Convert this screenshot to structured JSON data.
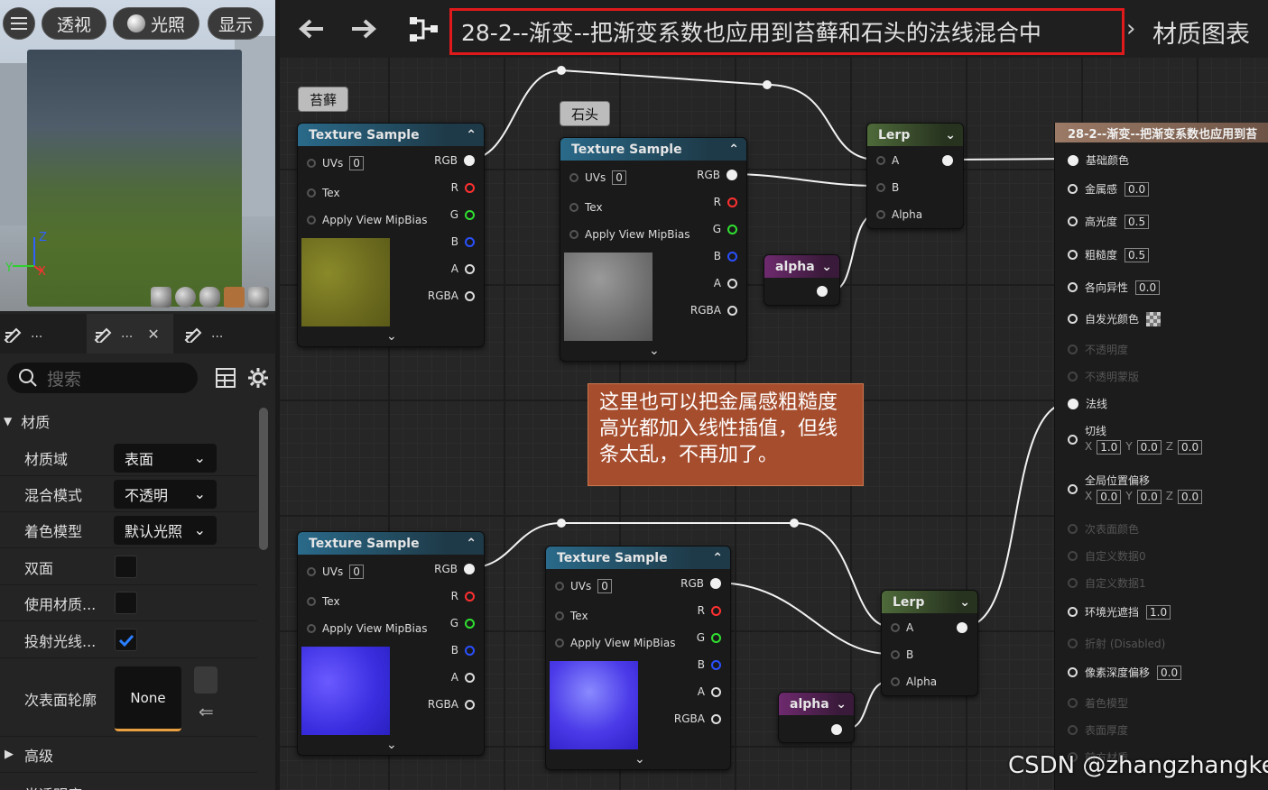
{
  "viewport": {
    "buttons": [
      "透视",
      "光照",
      "显示"
    ],
    "axes": {
      "z": "Z",
      "y": "Y",
      "x": "X"
    }
  },
  "details": {
    "tabs": [
      "...",
      "...",
      "..."
    ],
    "search_placeholder": "搜索",
    "section_material": "材质",
    "section_advanced": "高级",
    "section_translucency": "半透明度",
    "props": [
      {
        "label": "材质域",
        "value": "表面"
      },
      {
        "label": "混合模式",
        "value": "不透明"
      },
      {
        "label": "着色模型",
        "value": "默认光照"
      },
      {
        "label": "双面"
      },
      {
        "label": "使用材质..."
      },
      {
        "label": "投射光线..."
      },
      {
        "label": "次表面轮廓",
        "value": "None"
      }
    ]
  },
  "graph": {
    "breadcrumb_title": "28-2--渐变--把渐变系数也应用到苔藓和石头的法线混合中",
    "breadcrumb_tail": "材质图表",
    "tag_moss": "苔藓",
    "tag_stone": "石头",
    "texture_sample": {
      "title": "Texture Sample",
      "uvs": "UVs",
      "uvs_value": "0",
      "tex": "Tex",
      "mip": "Apply View MipBias",
      "outputs": [
        "RGB",
        "R",
        "G",
        "B",
        "A",
        "RGBA"
      ]
    },
    "lerp": {
      "title": "Lerp",
      "inputs": [
        "A",
        "B",
        "Alpha"
      ]
    },
    "alpha_param": {
      "title": "alpha"
    },
    "comment": "这里也可以把金属感粗糙度高光都加入线性插值，但线条太乱，不再加了。",
    "colors": {
      "r": "#ff3030",
      "g": "#30e030",
      "b": "#2a50ff",
      "accent": "#e0191b"
    },
    "result": {
      "title": "28-2--渐变--把渐变系数也应用到苔",
      "pins": [
        {
          "label": "基础颜色"
        },
        {
          "label": "金属感",
          "value": "0.0"
        },
        {
          "label": "高光度",
          "value": "0.5"
        },
        {
          "label": "粗糙度",
          "value": "0.5"
        },
        {
          "label": "各向异性",
          "value": "0.0"
        },
        {
          "label": "自发光颜色"
        },
        {
          "label": "不透明度"
        },
        {
          "label": "不透明蒙版"
        },
        {
          "label": "法线"
        },
        {
          "label": "切线",
          "x": "1.0",
          "y": "0.0",
          "z": "0.0"
        },
        {
          "label": "全局位置偏移",
          "x": "0.0",
          "y": "0.0",
          "z": "0.0"
        },
        {
          "label": "次表面颜色"
        },
        {
          "label": "自定义数据0"
        },
        {
          "label": "自定义数据1"
        },
        {
          "label": "环境光遮挡",
          "value": "1.0"
        },
        {
          "label": "折射 (Disabled)"
        },
        {
          "label": "像素深度偏移",
          "value": "0.0"
        },
        {
          "label": "着色模型"
        },
        {
          "label": "表面厚度"
        },
        {
          "label": "前方材质"
        }
      ],
      "xyz": [
        "X",
        "Y",
        "Z"
      ]
    }
  },
  "watermark": "CSDN @zhangzhangkeji"
}
